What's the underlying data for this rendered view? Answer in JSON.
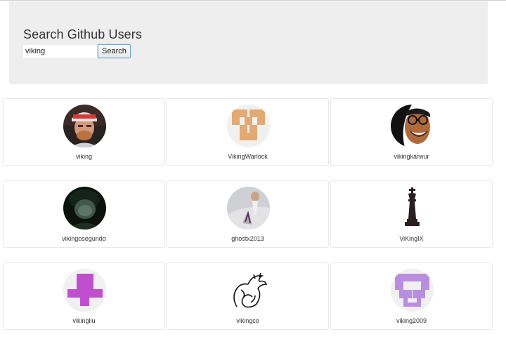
{
  "header": {
    "title": "Search Github Users",
    "search_value": "viking",
    "search_button_label": "Search"
  },
  "users": [
    {
      "login": "viking",
      "avatar": "photo-man-red-hat"
    },
    {
      "login": "VikingWarlock",
      "avatar": "identicon-tan"
    },
    {
      "login": "vikingkarwur",
      "avatar": "cartoon-glasses-face"
    },
    {
      "login": "vikingosegundo",
      "avatar": "photo-dark-portrait"
    },
    {
      "login": "ghostx2013",
      "avatar": "photo-light-figure"
    },
    {
      "login": "ViKingIX",
      "avatar": "chess-king-icon"
    },
    {
      "login": "vikingliu",
      "avatar": "identicon-magenta"
    },
    {
      "login": "vikingco",
      "avatar": "dragon-line-icon"
    },
    {
      "login": "viking2009",
      "avatar": "identicon-lavender"
    }
  ],
  "colors": {
    "jumbotron_bg": "#eeeeee",
    "tan": "#e2aa73",
    "magenta": "#c04fcf",
    "lavender": "#b98ee0"
  }
}
